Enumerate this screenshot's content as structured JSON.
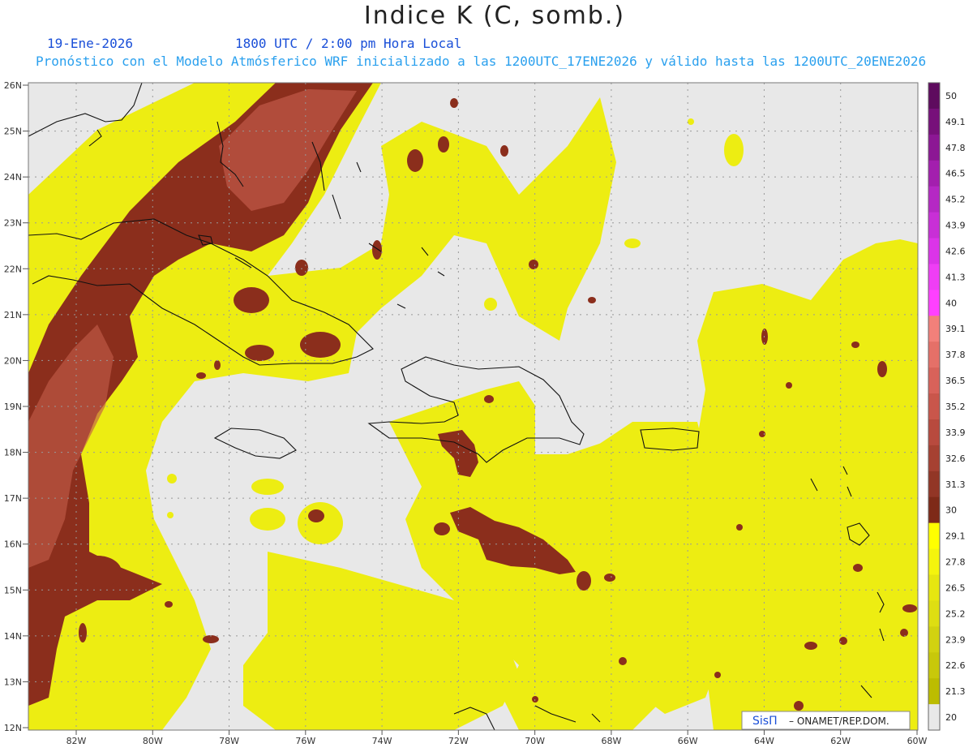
{
  "header": {
    "title": "Indice K (C, somb.)",
    "date": "19-Ene-2026",
    "time": "1800 UTC / 2:00 pm Hora Local",
    "info": "Pronóstico con el Modelo Atmósferico WRF inicializado a las 1200UTC_17ENE2026 y válido hasta las  1200UTC_20ENE2026"
  },
  "map": {
    "lat_labels": [
      "26N",
      "25N",
      "24N",
      "23N",
      "22N",
      "21N",
      "20N",
      "19N",
      "18N",
      "17N",
      "16N",
      "15N",
      "14N",
      "13N",
      "12N"
    ],
    "lon_labels": [
      "82W",
      "80W",
      "78W",
      "76W",
      "74W",
      "72W",
      "70W",
      "68W",
      "66W",
      "64W",
      "62W",
      "60W"
    ],
    "credit_logo": "SisΠ",
    "credit_text": "– ONAMET/REP.DOM."
  },
  "colorbar": {
    "labels": [
      "50",
      "49.1",
      "47.8",
      "46.5",
      "45.2",
      "43.9",
      "42.6",
      "41.3",
      "40",
      "39.1",
      "37.8",
      "36.5",
      "35.2",
      "33.9",
      "32.6",
      "31.3",
      "30",
      "29.1",
      "27.8",
      "26.5",
      "25.2",
      "23.9",
      "22.6",
      "21.3",
      "20"
    ],
    "colors": [
      "#5e0b5e",
      "#77107a",
      "#8c1794",
      "#a31fae",
      "#b528c4",
      "#c82fd6",
      "#db34e8",
      "#ef3ef5",
      "#ff40ff",
      "#f2807a",
      "#e57068",
      "#d8625a",
      "#c9564b",
      "#b84a3e",
      "#a64132",
      "#923626",
      "#7e2a18",
      "#ffff00",
      "#f4f40d",
      "#e6e610",
      "#dede12",
      "#d2d210",
      "#c8c80a",
      "#bcbc00",
      "#e8e8e8"
    ]
  },
  "colors": {
    "background": "#e8e8e8",
    "yellow_band": "#eded12",
    "yellow_dark": "#d6d40a",
    "brown_band": "#8b2e1c",
    "brown_light": "#c25a48"
  }
}
